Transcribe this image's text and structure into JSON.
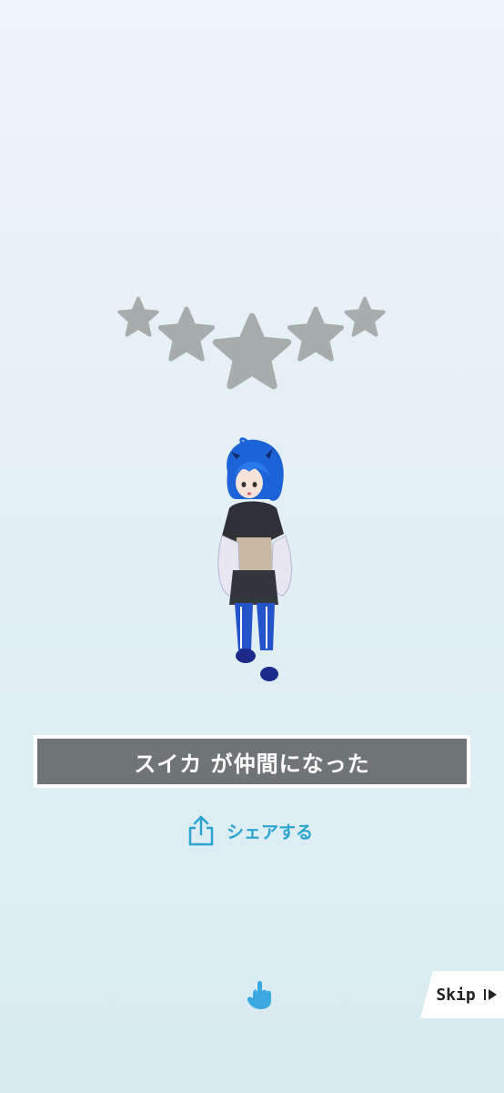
{
  "rating": {
    "stars": 5,
    "filled": 0,
    "star_color": "#a7acad"
  },
  "character": {
    "name": "スイカ",
    "hair_color": "#1d63d8"
  },
  "banner": {
    "text": "スイカ が仲間になった",
    "bg_color": "#6f7576"
  },
  "share": {
    "label": "シェアする",
    "icon": "share-icon",
    "color": "#2aa3cf"
  },
  "hint": {
    "icon": "tap-hand-icon"
  },
  "skip": {
    "label": "Skip",
    "icon": "skip-play-icon"
  }
}
